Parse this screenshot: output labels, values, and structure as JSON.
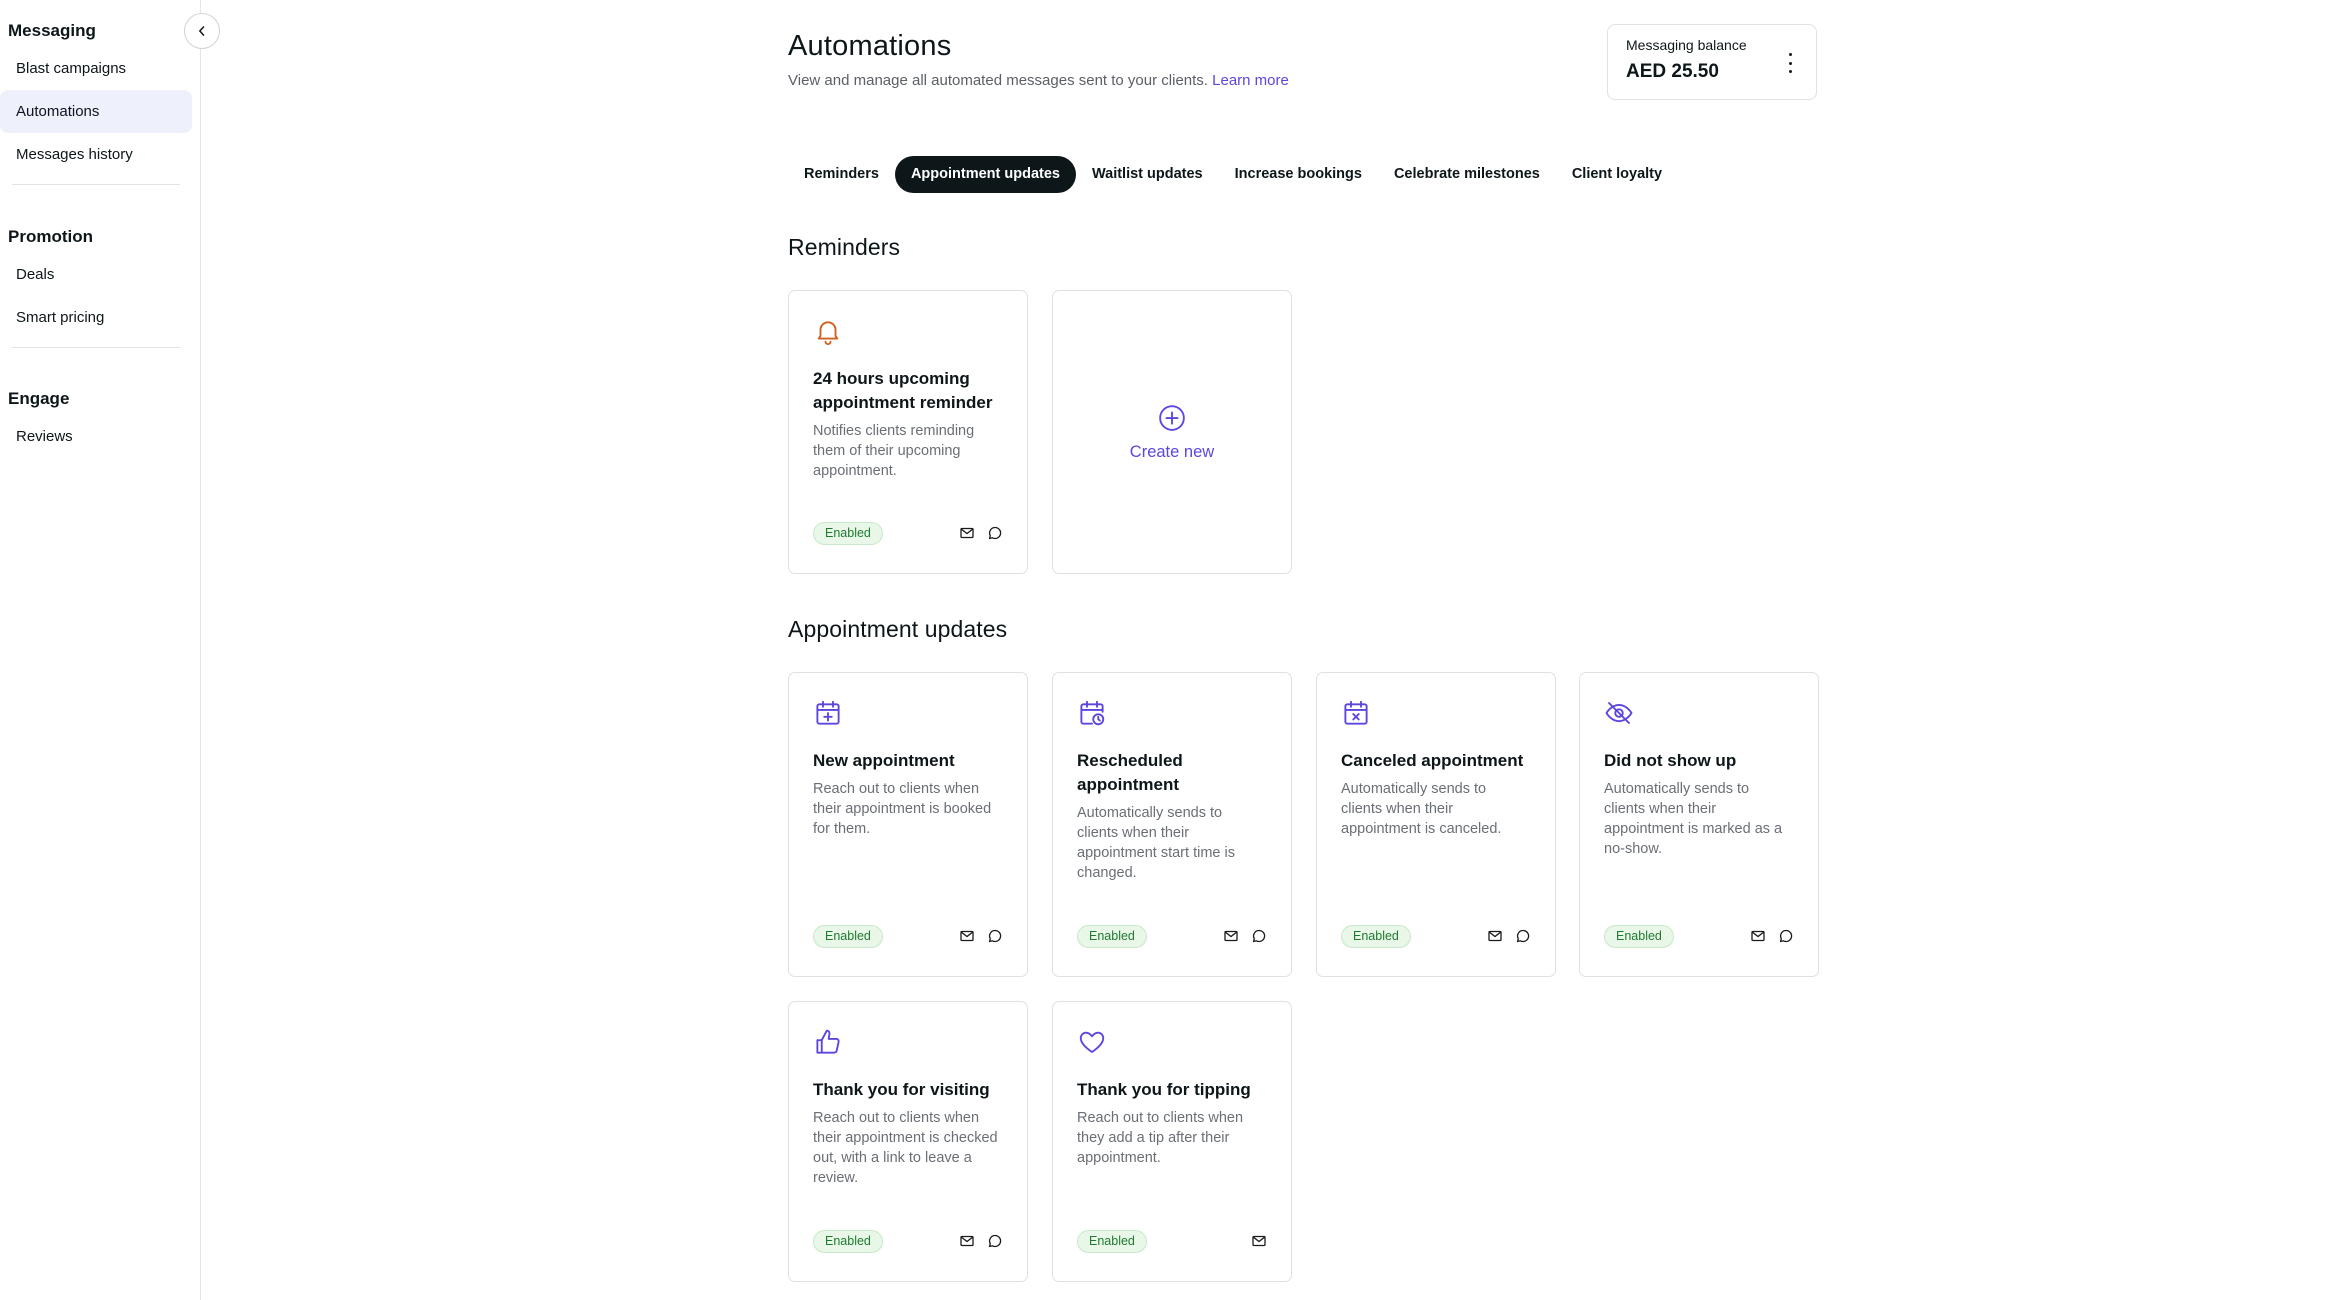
{
  "sidebar": {
    "sections": [
      {
        "heading": "Messaging",
        "items": [
          {
            "label": "Blast campaigns"
          },
          {
            "label": "Automations",
            "active": true
          },
          {
            "label": "Messages history"
          }
        ]
      },
      {
        "heading": "Promotion",
        "items": [
          {
            "label": "Deals"
          },
          {
            "label": "Smart pricing"
          }
        ]
      },
      {
        "heading": "Engage",
        "items": [
          {
            "label": "Reviews"
          }
        ]
      }
    ]
  },
  "header": {
    "title": "Automations",
    "subtitle": "View and manage all automated messages sent to your clients.",
    "learn_more": "Learn more"
  },
  "balance": {
    "label": "Messaging balance",
    "value": "AED 25.50"
  },
  "tabs": [
    {
      "label": "Reminders"
    },
    {
      "label": "Appointment updates",
      "active": true
    },
    {
      "label": "Waitlist updates"
    },
    {
      "label": "Increase bookings"
    },
    {
      "label": "Celebrate milestones"
    },
    {
      "label": "Client loyalty"
    }
  ],
  "reminders": {
    "title": "Reminders",
    "cards": [
      {
        "icon": "bell-icon",
        "title": "24 hours upcoming appointment reminder",
        "description": "Notifies clients reminding them of their upcoming appointment.",
        "status": "Enabled",
        "channels": [
          "email-icon",
          "chat-icon"
        ]
      }
    ],
    "create_label": "Create new"
  },
  "appointment_updates": {
    "title": "Appointment updates",
    "cards": [
      {
        "icon": "calendar-plus-icon",
        "title": "New appointment",
        "description": "Reach out to clients when their appointment is booked for them.",
        "status": "Enabled",
        "channels": [
          "email-icon",
          "chat-icon"
        ]
      },
      {
        "icon": "calendar-clock-icon",
        "title": "Rescheduled appointment",
        "description": "Automatically sends to clients when their appointment start time is changed.",
        "status": "Enabled",
        "channels": [
          "email-icon",
          "chat-icon"
        ]
      },
      {
        "icon": "calendar-x-icon",
        "title": "Canceled appointment",
        "description": "Automatically sends to clients when their appointment is canceled.",
        "status": "Enabled",
        "channels": [
          "email-icon",
          "chat-icon"
        ]
      },
      {
        "icon": "eye-off-icon",
        "title": "Did not show up",
        "description": "Automatically sends to clients when their appointment is marked as a no-show.",
        "status": "Enabled",
        "channels": [
          "email-icon",
          "chat-icon"
        ]
      },
      {
        "icon": "thumbs-up-icon",
        "title": "Thank you for visiting",
        "description": "Reach out to clients when their appointment is checked out, with a link to leave a review.",
        "status": "Enabled",
        "channels": [
          "email-icon",
          "chat-icon"
        ]
      },
      {
        "icon": "heart-icon",
        "title": "Thank you for tipping",
        "description": "Reach out to clients when they add a tip after their appointment.",
        "status": "Enabled",
        "channels": [
          "email-icon"
        ]
      }
    ]
  },
  "colors": {
    "accent": "#5b47e0",
    "reminder_icon": "#d0611f",
    "enabled_text": "#1f7a2f",
    "enabled_bg": "#e9f7e9"
  }
}
